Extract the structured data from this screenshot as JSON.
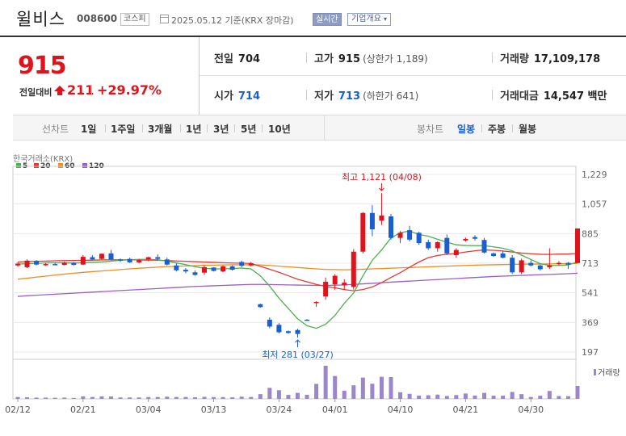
{
  "header": {
    "name": "윌비스",
    "code": "008600",
    "market": "코스피",
    "date_text": "2025.05.12 기준(KRX 장마감)",
    "realtime_label": "실시간",
    "company_info_label": "기업개요"
  },
  "price": {
    "current": "915",
    "change_label": "전일대비",
    "change_value": "211",
    "change_pct": "+29.97%"
  },
  "stats": {
    "prev_label": "전일",
    "prev_value": "704",
    "high_label": "고가",
    "high_value": "915",
    "high_sub": "(상한가 1,189)",
    "volume_label": "거래량",
    "volume_value": "17,109,178",
    "open_label": "시가",
    "open_value": "714",
    "low_label": "저가",
    "low_value": "713",
    "low_sub": "(하한가 641)",
    "amount_label": "거래대금",
    "amount_value": "14,547 백만"
  },
  "period_bar": {
    "line_label": "선차트",
    "periods": [
      "1일",
      "1주일",
      "3개월",
      "1년",
      "3년",
      "5년",
      "10년"
    ],
    "candle_label": "봉차트",
    "candle_periods": [
      "일봉",
      "주봉",
      "월봉"
    ],
    "candle_selected": "일봉"
  },
  "chart_data": {
    "type": "candlestick",
    "source": "한국거래소(KRX)",
    "volume_label": "거래량",
    "ylim": [
      197,
      1229
    ],
    "yticks": [
      197,
      369,
      541,
      713,
      885,
      1057,
      1229
    ],
    "ytick_labels": [
      "197",
      "369",
      "541",
      "713",
      "885",
      "1,057",
      "1,229"
    ],
    "xtick_labels": [
      "02/12",
      "02/21",
      "03/04",
      "03/13",
      "03/24",
      "04/01",
      "04/10",
      "04/21",
      "04/30"
    ],
    "xtick_index": [
      0,
      7,
      14,
      21,
      28,
      34,
      41,
      48,
      55
    ],
    "legend": [
      {
        "name": "5",
        "color": "#4caf50"
      },
      {
        "name": "20",
        "color": "#e53935"
      },
      {
        "name": "60",
        "color": "#ef8c24"
      },
      {
        "name": "120",
        "color": "#9c5fc1"
      }
    ],
    "annotations": {
      "high_text": "최고 1,121 (04/08)",
      "low_text": "최저 281 (03/27)",
      "high_value": 1121,
      "high_index": 39,
      "low_value": 281,
      "low_index": 30
    },
    "candles": [
      {
        "o": 700,
        "h": 718,
        "l": 692,
        "c": 710
      },
      {
        "o": 690,
        "h": 735,
        "l": 685,
        "c": 728
      },
      {
        "o": 725,
        "h": 732,
        "l": 700,
        "c": 705
      },
      {
        "o": 705,
        "h": 715,
        "l": 698,
        "c": 708
      },
      {
        "o": 708,
        "h": 716,
        "l": 702,
        "c": 703
      },
      {
        "o": 703,
        "h": 722,
        "l": 700,
        "c": 716
      },
      {
        "o": 715,
        "h": 720,
        "l": 700,
        "c": 703
      },
      {
        "o": 705,
        "h": 760,
        "l": 702,
        "c": 750
      },
      {
        "o": 748,
        "h": 760,
        "l": 730,
        "c": 735
      },
      {
        "o": 738,
        "h": 770,
        "l": 735,
        "c": 768
      },
      {
        "o": 770,
        "h": 790,
        "l": 730,
        "c": 735
      },
      {
        "o": 735,
        "h": 740,
        "l": 720,
        "c": 728
      },
      {
        "o": 738,
        "h": 745,
        "l": 715,
        "c": 718
      },
      {
        "o": 718,
        "h": 738,
        "l": 712,
        "c": 730
      },
      {
        "o": 735,
        "h": 750,
        "l": 725,
        "c": 748
      },
      {
        "o": 748,
        "h": 765,
        "l": 730,
        "c": 738
      },
      {
        "o": 735,
        "h": 745,
        "l": 700,
        "c": 705
      },
      {
        "o": 700,
        "h": 712,
        "l": 665,
        "c": 672
      },
      {
        "o": 675,
        "h": 685,
        "l": 655,
        "c": 665
      },
      {
        "o": 660,
        "h": 670,
        "l": 640,
        "c": 645
      },
      {
        "o": 658,
        "h": 700,
        "l": 645,
        "c": 690
      },
      {
        "o": 688,
        "h": 690,
        "l": 665,
        "c": 668
      },
      {
        "o": 665,
        "h": 700,
        "l": 660,
        "c": 695
      },
      {
        "o": 695,
        "h": 700,
        "l": 670,
        "c": 675
      },
      {
        "o": 720,
        "h": 728,
        "l": 690,
        "c": 698
      },
      {
        "o": 700,
        "h": 720,
        "l": 695,
        "c": 712
      },
      {
        "o": 475,
        "h": 478,
        "l": 455,
        "c": 458
      },
      {
        "o": 385,
        "h": 398,
        "l": 335,
        "c": 345
      },
      {
        "o": 355,
        "h": 365,
        "l": 305,
        "c": 312
      },
      {
        "o": 318,
        "h": 322,
        "l": 303,
        "c": 308
      },
      {
        "o": 325,
        "h": 332,
        "l": 281,
        "c": 302
      },
      {
        "o": 385,
        "h": 388,
        "l": 380,
        "c": 384
      },
      {
        "o": 487,
        "h": 492,
        "l": 460,
        "c": 488
      },
      {
        "o": 520,
        "h": 630,
        "l": 500,
        "c": 605
      },
      {
        "o": 590,
        "h": 650,
        "l": 560,
        "c": 640
      },
      {
        "o": 585,
        "h": 620,
        "l": 560,
        "c": 600
      },
      {
        "o": 575,
        "h": 795,
        "l": 560,
        "c": 780
      },
      {
        "o": 780,
        "h": 1010,
        "l": 770,
        "c": 1005
      },
      {
        "o": 1005,
        "h": 1050,
        "l": 870,
        "c": 910
      },
      {
        "o": 960,
        "h": 1121,
        "l": 935,
        "c": 990
      },
      {
        "o": 985,
        "h": 1000,
        "l": 850,
        "c": 860
      },
      {
        "o": 860,
        "h": 900,
        "l": 830,
        "c": 890
      },
      {
        "o": 905,
        "h": 930,
        "l": 840,
        "c": 850
      },
      {
        "o": 890,
        "h": 895,
        "l": 820,
        "c": 830
      },
      {
        "o": 835,
        "h": 850,
        "l": 790,
        "c": 800
      },
      {
        "o": 800,
        "h": 840,
        "l": 780,
        "c": 835
      },
      {
        "o": 860,
        "h": 880,
        "l": 760,
        "c": 770
      },
      {
        "o": 760,
        "h": 800,
        "l": 745,
        "c": 790
      },
      {
        "o": 845,
        "h": 862,
        "l": 838,
        "c": 854
      },
      {
        "o": 865,
        "h": 876,
        "l": 845,
        "c": 855
      },
      {
        "o": 848,
        "h": 860,
        "l": 770,
        "c": 775
      },
      {
        "o": 770,
        "h": 775,
        "l": 750,
        "c": 755
      },
      {
        "o": 770,
        "h": 785,
        "l": 740,
        "c": 745
      },
      {
        "o": 745,
        "h": 760,
        "l": 650,
        "c": 660
      },
      {
        "o": 660,
        "h": 740,
        "l": 650,
        "c": 730
      },
      {
        "o": 715,
        "h": 730,
        "l": 695,
        "c": 700
      },
      {
        "o": 700,
        "h": 705,
        "l": 670,
        "c": 678
      },
      {
        "o": 690,
        "h": 800,
        "l": 680,
        "c": 700
      },
      {
        "o": 710,
        "h": 725,
        "l": 700,
        "c": 715
      },
      {
        "o": 715,
        "h": 720,
        "l": 680,
        "c": 705
      },
      {
        "o": 714,
        "h": 915,
        "l": 713,
        "c": 915
      }
    ],
    "volume": [
      1.2,
      1.0,
      0.8,
      0.8,
      0.7,
      0.8,
      0.6,
      1.6,
      1.2,
      1.6,
      1.5,
      0.9,
      0.9,
      0.9,
      1.1,
      1.2,
      1.4,
      1.2,
      1.2,
      1.0,
      1.3,
      1.1,
      1.1,
      1.0,
      1.4,
      1.2,
      3.0,
      7.0,
      5.5,
      2.5,
      3.8,
      2.6,
      9.5,
      21.0,
      14.5,
      5.2,
      8.6,
      13.5,
      9.6,
      14.0,
      13.8,
      4.2,
      3.2,
      2.1,
      2.3,
      2.7,
      1.8,
      2.4,
      3.4,
      2.1,
      3.8,
      2.0,
      2.0,
      4.4,
      3.0,
      1.2,
      2.0,
      5.0,
      1.8,
      1.7,
      8.2
    ],
    "ma5": [
      708,
      710,
      712,
      714,
      716,
      715,
      714,
      716,
      718,
      720,
      725,
      730,
      733,
      735,
      735,
      733,
      725,
      715,
      705,
      693,
      683,
      680,
      680,
      682,
      685,
      680,
      640,
      580,
      510,
      450,
      390,
      350,
      335,
      358,
      410,
      480,
      540,
      640,
      730,
      790,
      860,
      890,
      900,
      880,
      870,
      852,
      835,
      820,
      816,
      815,
      815,
      808,
      800,
      785,
      760,
      735,
      710,
      700,
      700,
      703,
      720
    ],
    "ma20": [
      720,
      722,
      724,
      725,
      727,
      728,
      729,
      730,
      731,
      732,
      733,
      733,
      733,
      732,
      731,
      730,
      728,
      726,
      724,
      722,
      720,
      718,
      716,
      714,
      713,
      712,
      695,
      678,
      660,
      640,
      620,
      605,
      590,
      578,
      570,
      560,
      553,
      560,
      575,
      600,
      630,
      658,
      690,
      720,
      745,
      758,
      765,
      770,
      778,
      785,
      790,
      788,
      784,
      778,
      772,
      768,
      765,
      764,
      766,
      766,
      770
    ],
    "ma60": [
      620,
      626,
      632,
      638,
      644,
      650,
      655,
      660,
      664,
      668,
      672,
      676,
      680,
      684,
      687,
      690,
      693,
      695,
      697,
      699,
      701,
      702,
      703,
      704,
      704,
      704,
      703,
      700,
      696,
      692,
      688,
      684,
      680,
      677,
      676,
      675,
      676,
      678,
      680,
      682,
      684,
      686,
      688,
      690,
      692,
      694,
      696,
      698,
      700,
      702,
      703,
      704,
      705,
      706,
      707,
      708,
      708,
      709,
      710,
      710,
      712
    ],
    "ma120": [
      520,
      524,
      527,
      530,
      533,
      536,
      539,
      542,
      545,
      548,
      551,
      554,
      557,
      560,
      563,
      566,
      569,
      572,
      575,
      578,
      580,
      582,
      584,
      586,
      588,
      590,
      590,
      589,
      588,
      587,
      586,
      585,
      584,
      584,
      585,
      587,
      590,
      593,
      596,
      600,
      603,
      606,
      609,
      612,
      615,
      618,
      621,
      624,
      627,
      630,
      633,
      636,
      638,
      640,
      642,
      644,
      646,
      648,
      650,
      652,
      655
    ]
  }
}
